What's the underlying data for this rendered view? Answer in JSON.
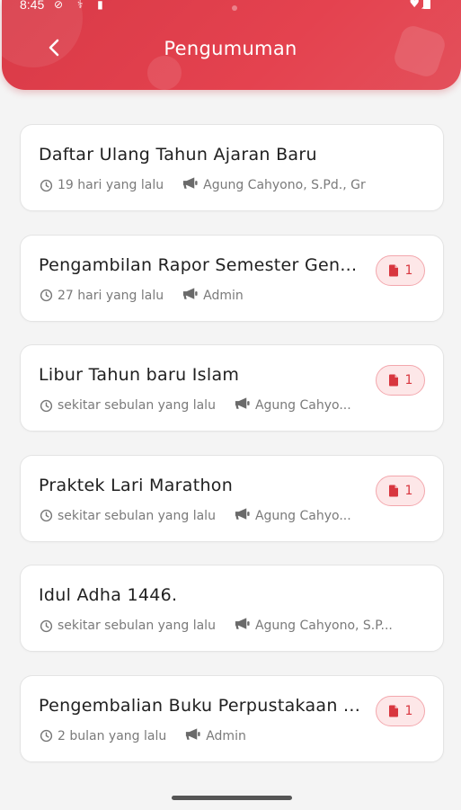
{
  "status_bar": {
    "time": "8:45"
  },
  "header": {
    "title": "Pengumuman"
  },
  "colors": {
    "accent": "#e0404c",
    "badge_bg": "#fde7e8",
    "badge_fg": "#d8363f"
  },
  "announcements": [
    {
      "title": "Daftar Ulang Tahun Ajaran Baru",
      "time": "19 hari yang lalu",
      "author": "Agung Cahyono, S.Pd., Gr",
      "attachments": null
    },
    {
      "title": "Pengambilan Rapor Semester Gen...",
      "time": "27 hari yang lalu",
      "author": "Admin",
      "attachments": "1"
    },
    {
      "title": "Libur Tahun baru Islam",
      "time": "sekitar sebulan yang lalu",
      "author": "Agung Cahyo...",
      "attachments": "1"
    },
    {
      "title": "Praktek Lari Marathon",
      "time": "sekitar sebulan yang lalu",
      "author": "Agung Cahyo...",
      "attachments": "1"
    },
    {
      "title": "Idul Adha 1446.",
      "time": "sekitar sebulan yang lalu",
      "author": "Agung Cahyono, S.P...",
      "attachments": null
    },
    {
      "title": "Pengembalian Buku Perpustakaan ...",
      "time": "2 bulan yang lalu",
      "author": "Admin",
      "attachments": "1"
    }
  ]
}
